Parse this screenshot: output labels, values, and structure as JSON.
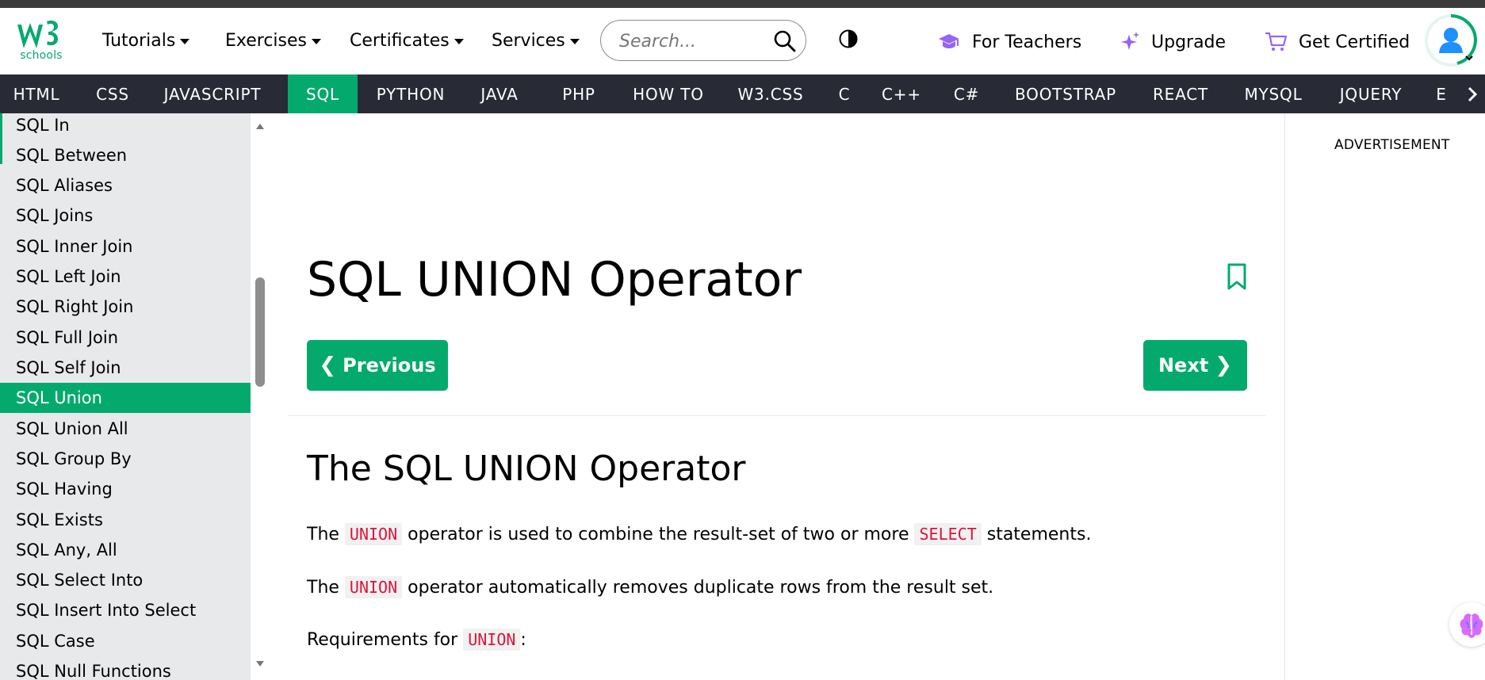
{
  "brand": {
    "logo_text": "schools",
    "logo_mark": "w3"
  },
  "header": {
    "menu": [
      {
        "label": "Tutorials"
      },
      {
        "label": "Exercises"
      },
      {
        "label": "Certificates"
      },
      {
        "label": "Services"
      }
    ],
    "search_placeholder": "Search...",
    "for_teachers": "For Teachers",
    "upgrade": "Upgrade",
    "get_certified": "Get Certified"
  },
  "tabs": [
    {
      "label": "HTML"
    },
    {
      "label": "CSS"
    },
    {
      "label": "JAVASCRIPT"
    },
    {
      "label": "SQL"
    },
    {
      "label": "PYTHON"
    },
    {
      "label": "JAVA"
    },
    {
      "label": "PHP"
    },
    {
      "label": "HOW TO"
    },
    {
      "label": "W3.CSS"
    },
    {
      "label": "C"
    },
    {
      "label": "C++"
    },
    {
      "label": "C#"
    },
    {
      "label": "BOOTSTRAP"
    },
    {
      "label": "REACT"
    },
    {
      "label": "MYSQL"
    },
    {
      "label": "JQUERY"
    },
    {
      "label": "E"
    }
  ],
  "sidebar": {
    "items": [
      {
        "label": "SQL In"
      },
      {
        "label": "SQL Between"
      },
      {
        "label": "SQL Aliases"
      },
      {
        "label": "SQL Joins"
      },
      {
        "label": "SQL Inner Join"
      },
      {
        "label": "SQL Left Join"
      },
      {
        "label": "SQL Right Join"
      },
      {
        "label": "SQL Full Join"
      },
      {
        "label": "SQL Self Join"
      },
      {
        "label": "SQL Union"
      },
      {
        "label": "SQL Union All"
      },
      {
        "label": "SQL Group By"
      },
      {
        "label": "SQL Having"
      },
      {
        "label": "SQL Exists"
      },
      {
        "label": "SQL Any, All"
      },
      {
        "label": "SQL Select Into"
      },
      {
        "label": "SQL Insert Into Select"
      },
      {
        "label": "SQL Case"
      },
      {
        "label": "SQL Null Functions"
      }
    ]
  },
  "main": {
    "title": "SQL UNION Operator",
    "previous": "Previous",
    "next": "Next",
    "section_title": "The SQL UNION Operator",
    "p1_before": "The",
    "p1_code1": "UNION",
    "p1_middle": "operator is used to combine the result-set of two or more",
    "p1_code2": "SELECT",
    "p1_after": "statements.",
    "p2_before": "The",
    "p2_code": "UNION",
    "p2_after": "operator automatically removes duplicate rows from the result set.",
    "p3_before": "Requirements for",
    "p3_code": "UNION",
    "p3_after": ":"
  },
  "ad": {
    "label": "ADVERTISEMENT"
  },
  "theme": {
    "accent": "#04AA6D",
    "tab_bg": "#282A35",
    "sidebar_bg": "#E7E9EB",
    "code_red": "#DC143C",
    "purple": "#9763F6"
  },
  "icons": [
    "w3schools-logo",
    "caret-down-icon",
    "search-icon",
    "contrast-icon",
    "graduation-cap-icon",
    "sparkle-icon",
    "cart-icon",
    "user-avatar-icon",
    "bookmark-icon",
    "chevron-left-icon",
    "chevron-right-icon",
    "brain-icon"
  ]
}
